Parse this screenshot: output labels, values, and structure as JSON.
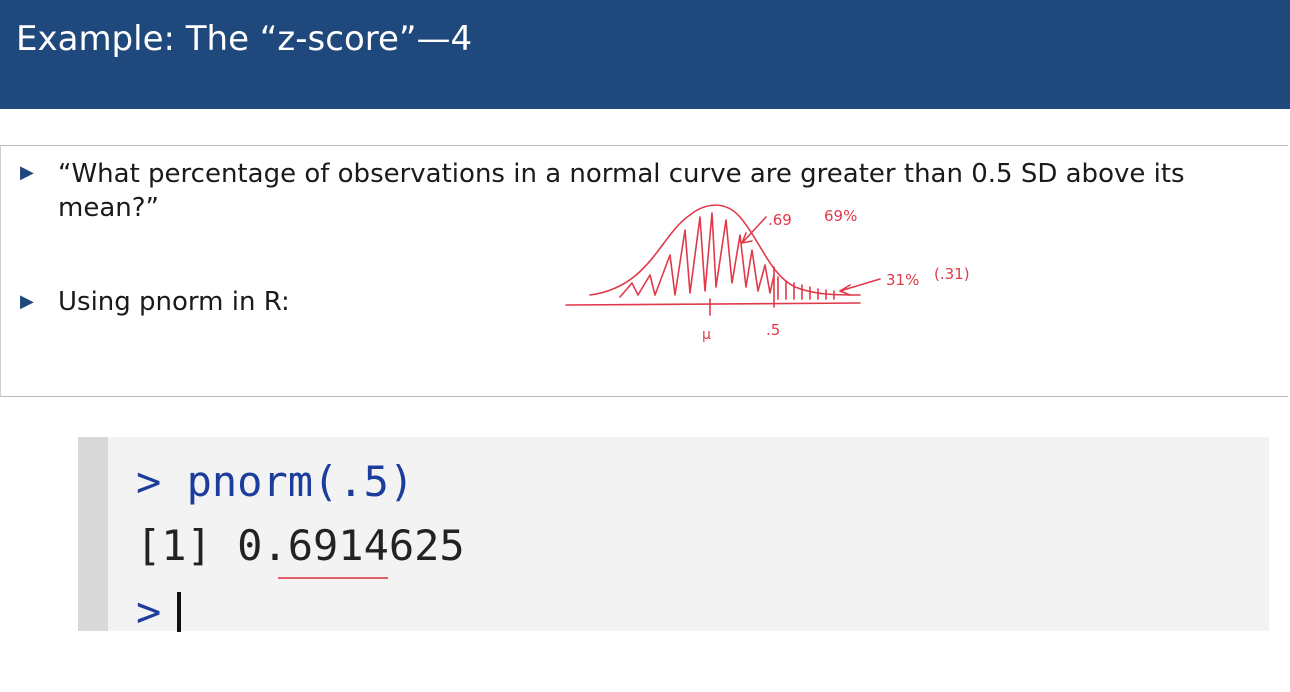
{
  "slide": {
    "title": "Example: The “z-score”—4",
    "bullets": [
      {
        "text": "“What percentage of observations in a normal curve are greater than 0.5 SD above its mean?”"
      },
      {
        "text": "Using pnorm in R:"
      }
    ]
  },
  "annotation": {
    "left_value": ".69",
    "left_percent": "69%",
    "right_value": "31%",
    "right_paren": "(.31)",
    "mu_label": "μ",
    "z_label": ".5",
    "ink_color": "#e03a4a"
  },
  "console": {
    "prompt": ">",
    "command": "pnorm(.5)",
    "output": "[1] 0.6914625",
    "next_prompt": ">"
  },
  "colors": {
    "title_bar": "#1f497d",
    "bullet_marker": "#1f497d",
    "console_text": "#1d3d9c"
  }
}
